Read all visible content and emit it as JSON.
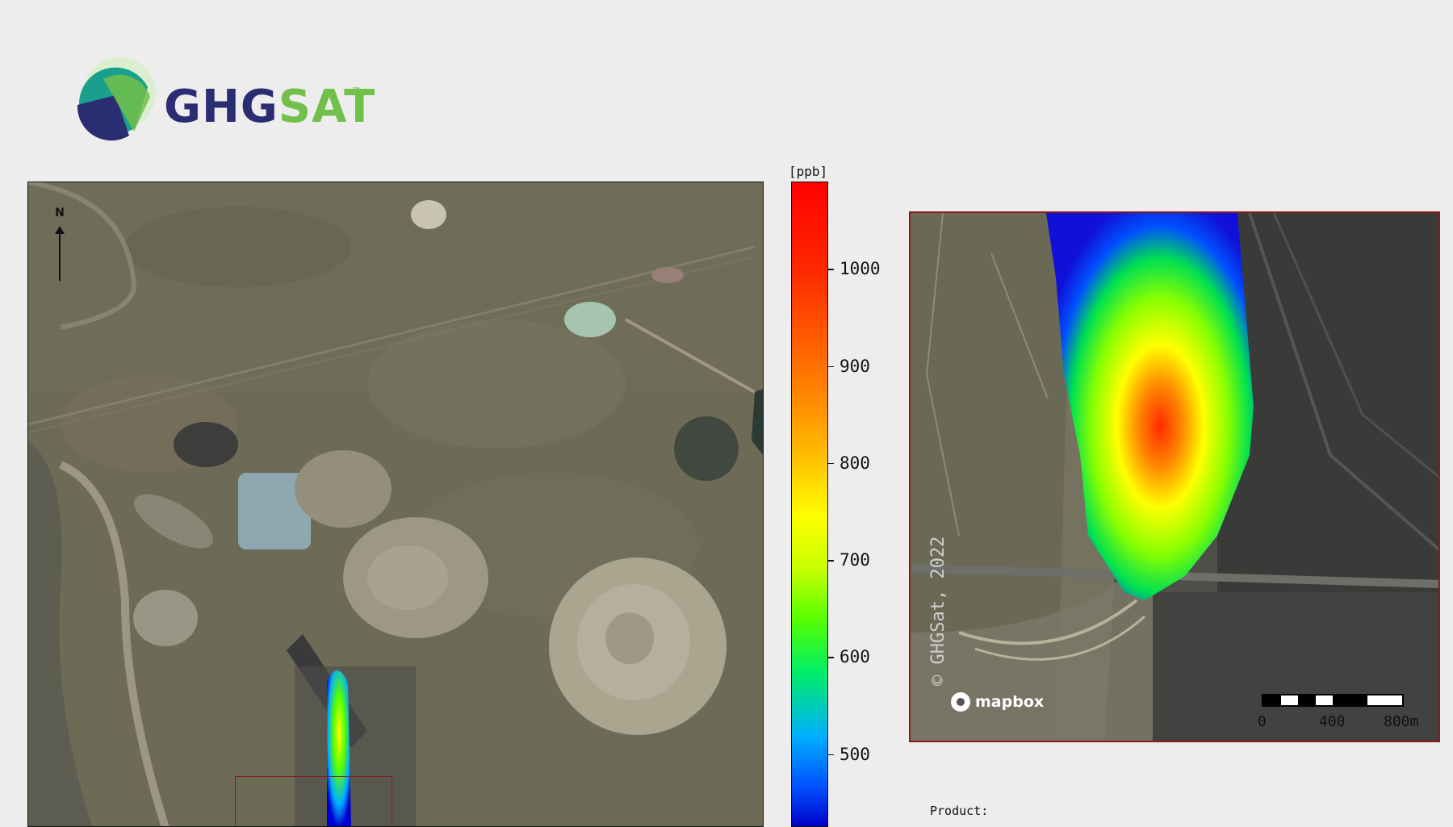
{
  "logo": {
    "brand_part1": "GHG",
    "brand_part2": "SAT",
    "trademark": "™",
    "colors": {
      "dark": "#2b2d72",
      "green": "#72c04a",
      "teal": "#1a9f8c"
    }
  },
  "main_map": {
    "north_label": "N",
    "roi_color": "#8b1a1a"
  },
  "colorbar": {
    "unit": "[ppb]",
    "ticks": [
      {
        "label": "1000",
        "value": 1000
      },
      {
        "label": "900",
        "value": 900
      },
      {
        "label": "800",
        "value": 800
      },
      {
        "label": "700",
        "value": 700
      },
      {
        "label": "600",
        "value": 600
      },
      {
        "label": "500",
        "value": 500
      }
    ],
    "range": [
      425,
      1090
    ],
    "colormap": "jet"
  },
  "inset": {
    "copyright": "© GHGSat, 2022",
    "attribution": "mapbox",
    "scale_labels": [
      "0",
      "400",
      "800m"
    ],
    "frame_color": "#8b1a1a"
  },
  "footer": {
    "product_label": "Product:"
  }
}
